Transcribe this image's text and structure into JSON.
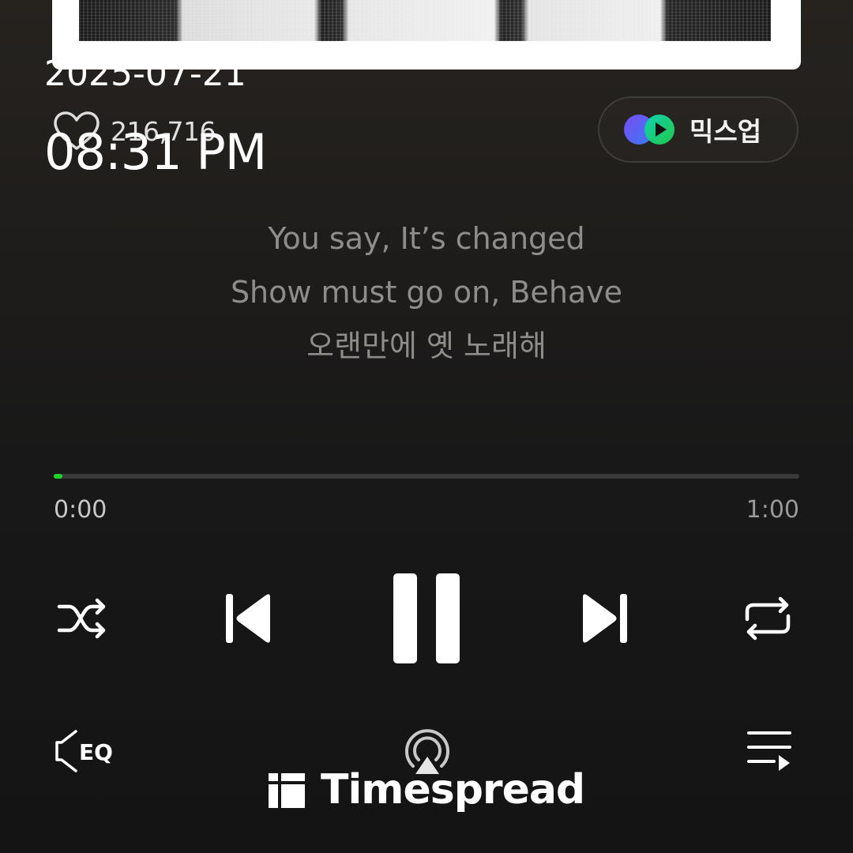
{
  "status_overlay": {
    "date": "2025-07-21",
    "time": "08:31 PM"
  },
  "track": {
    "like_count": "216,716",
    "mixup_label": "믹스업",
    "lyrics": [
      "You say, It’s changed",
      "Show must go on, Behave",
      "오랜만에 옛 노래해"
    ]
  },
  "playback": {
    "elapsed": "0:00",
    "duration": "1:00",
    "progress_fraction": 0.012,
    "state": "playing"
  },
  "controls": {
    "icons": [
      "shuffle-icon",
      "previous-icon",
      "pause-icon",
      "next-icon",
      "repeat-icon",
      "equalizer-icon",
      "cast-icon",
      "playlist-icon"
    ],
    "eq_label": "EQ"
  },
  "colors": {
    "accent": "#1ed32a",
    "mixup_gradient": [
      "#6b4cf6",
      "#13c27a"
    ]
  },
  "watermark": {
    "text": "Timespread"
  }
}
